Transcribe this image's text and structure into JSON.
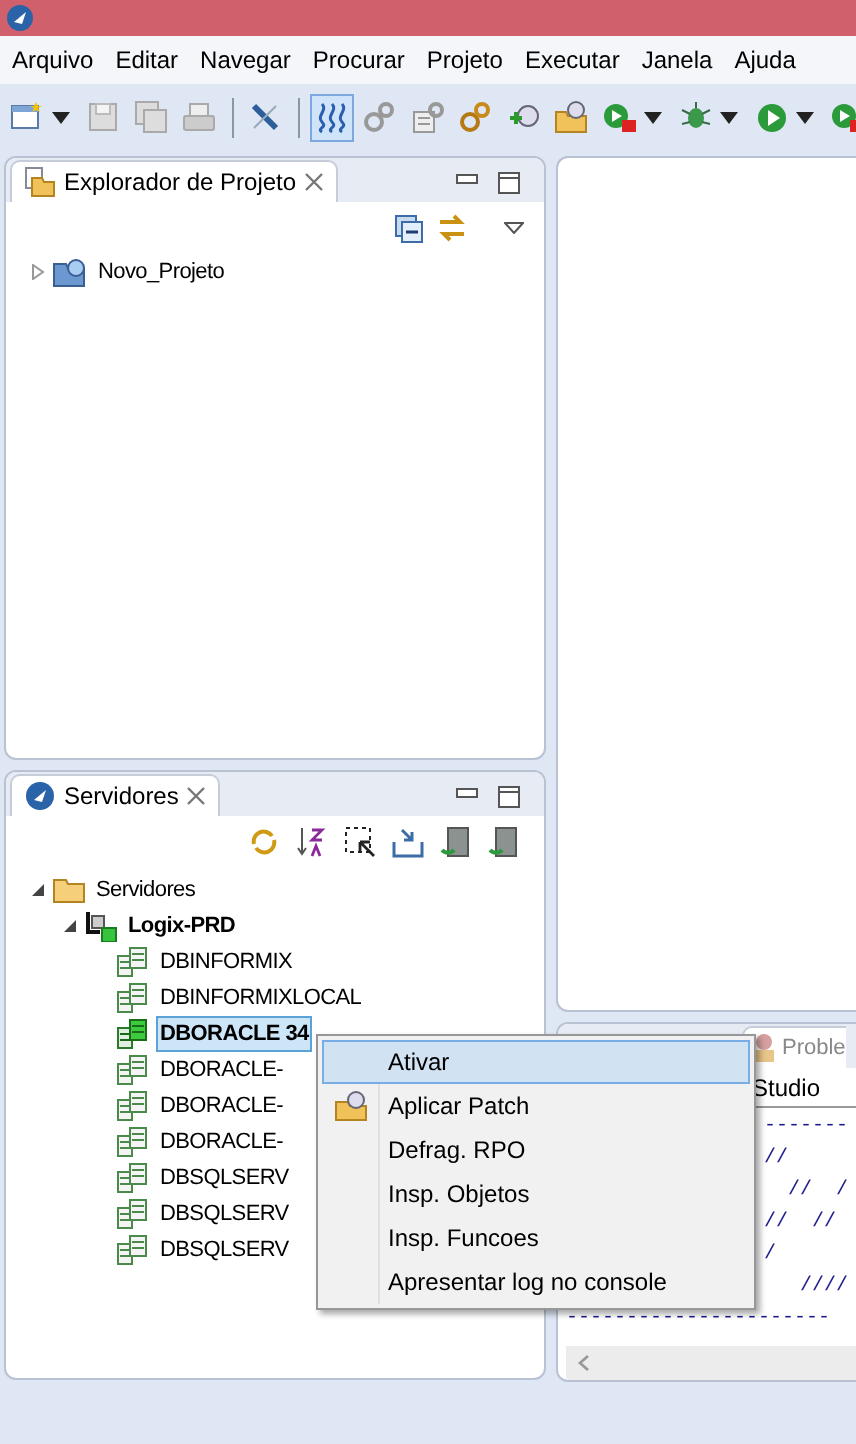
{
  "menu_bar": [
    "Arquivo",
    "Editar",
    "Navegar",
    "Procurar",
    "Projeto",
    "Executar",
    "Janela",
    "Ajuda"
  ],
  "toolbar": [
    {
      "kind": "new",
      "selected": false,
      "dropdown": true
    },
    {
      "kind": "save",
      "selected": false,
      "dropdown": false
    },
    {
      "kind": "save-all",
      "selected": false,
      "dropdown": false
    },
    {
      "kind": "print",
      "selected": false,
      "dropdown": false
    },
    {
      "kind": "sep"
    },
    {
      "kind": "pen",
      "selected": false,
      "dropdown": false
    },
    {
      "kind": "sep"
    },
    {
      "kind": "wave",
      "selected": true,
      "dropdown": false
    },
    {
      "kind": "gears",
      "selected": false,
      "dropdown": false
    },
    {
      "kind": "gear-doc",
      "selected": false,
      "dropdown": false
    },
    {
      "kind": "gears-gold",
      "selected": false,
      "dropdown": false
    },
    {
      "kind": "patch",
      "selected": false,
      "dropdown": false
    },
    {
      "kind": "folder-patch",
      "selected": false,
      "dropdown": false
    },
    {
      "kind": "run-stop",
      "selected": false,
      "dropdown": true
    },
    {
      "kind": "bug",
      "selected": false,
      "dropdown": true
    },
    {
      "kind": "run",
      "selected": false,
      "dropdown": true
    },
    {
      "kind": "run-stop",
      "selected": false,
      "dropdown": false
    }
  ],
  "explorer": {
    "title": "Explorador de Projeto",
    "tree": [
      {
        "label": "Novo_Projeto",
        "expanded": false
      }
    ]
  },
  "servers": {
    "title": "Servidores",
    "tree": [
      {
        "label": "Servidores",
        "kind": "folder",
        "expanded": true,
        "active": false,
        "selected": false,
        "children": [
          {
            "label": "Logix-PRD",
            "kind": "group",
            "expanded": true,
            "active": true,
            "selected": false,
            "children": [
              {
                "label": "DBINFORMIX",
                "kind": "db",
                "active": false,
                "selected": false
              },
              {
                "label": "DBINFORMIXLOCAL",
                "kind": "db",
                "active": false,
                "selected": false
              },
              {
                "label": "DBORACLE 34",
                "kind": "db",
                "active": true,
                "selected": true
              },
              {
                "label": "DBORACLE-",
                "kind": "db",
                "active": false,
                "selected": false
              },
              {
                "label": "DBORACLE-",
                "kind": "db",
                "active": false,
                "selected": false
              },
              {
                "label": "DBORACLE-",
                "kind": "db",
                "active": false,
                "selected": false
              },
              {
                "label": "DBSQLSERV",
                "kind": "db",
                "active": false,
                "selected": false
              },
              {
                "label": "DBSQLSERV",
                "kind": "db",
                "active": false,
                "selected": false
              },
              {
                "label": "DBSQLSERV",
                "kind": "db",
                "active": false,
                "selected": false
              }
            ]
          }
        ]
      }
    ]
  },
  "console": {
    "tab": "Proble",
    "header": "Studio",
    "lines": [
      {
        "kind": "clipped",
        "text": "-------"
      },
      {
        "kind": "clipped",
        "text": "//"
      },
      {
        "kind": "clipped",
        "text": "  //  /"
      },
      {
        "kind": "clipped",
        "text": "//  //"
      },
      {
        "kind": "clipped",
        "text": "/"
      },
      {
        "kind": "clipped",
        "text": "   ////"
      },
      {
        "kind": "full",
        "text": "----------------------"
      }
    ]
  },
  "context_menu": [
    {
      "label": "Ativar",
      "selected": true,
      "icon": false
    },
    {
      "label": "Aplicar Patch",
      "selected": false,
      "icon": true
    },
    {
      "label": "Defrag. RPO",
      "selected": false,
      "icon": false
    },
    {
      "label": "Insp. Objetos",
      "selected": false,
      "icon": false
    },
    {
      "label": "Insp. Funcoes",
      "selected": false,
      "icon": false
    },
    {
      "label": "Apresentar log no console",
      "selected": false,
      "icon": false
    }
  ]
}
